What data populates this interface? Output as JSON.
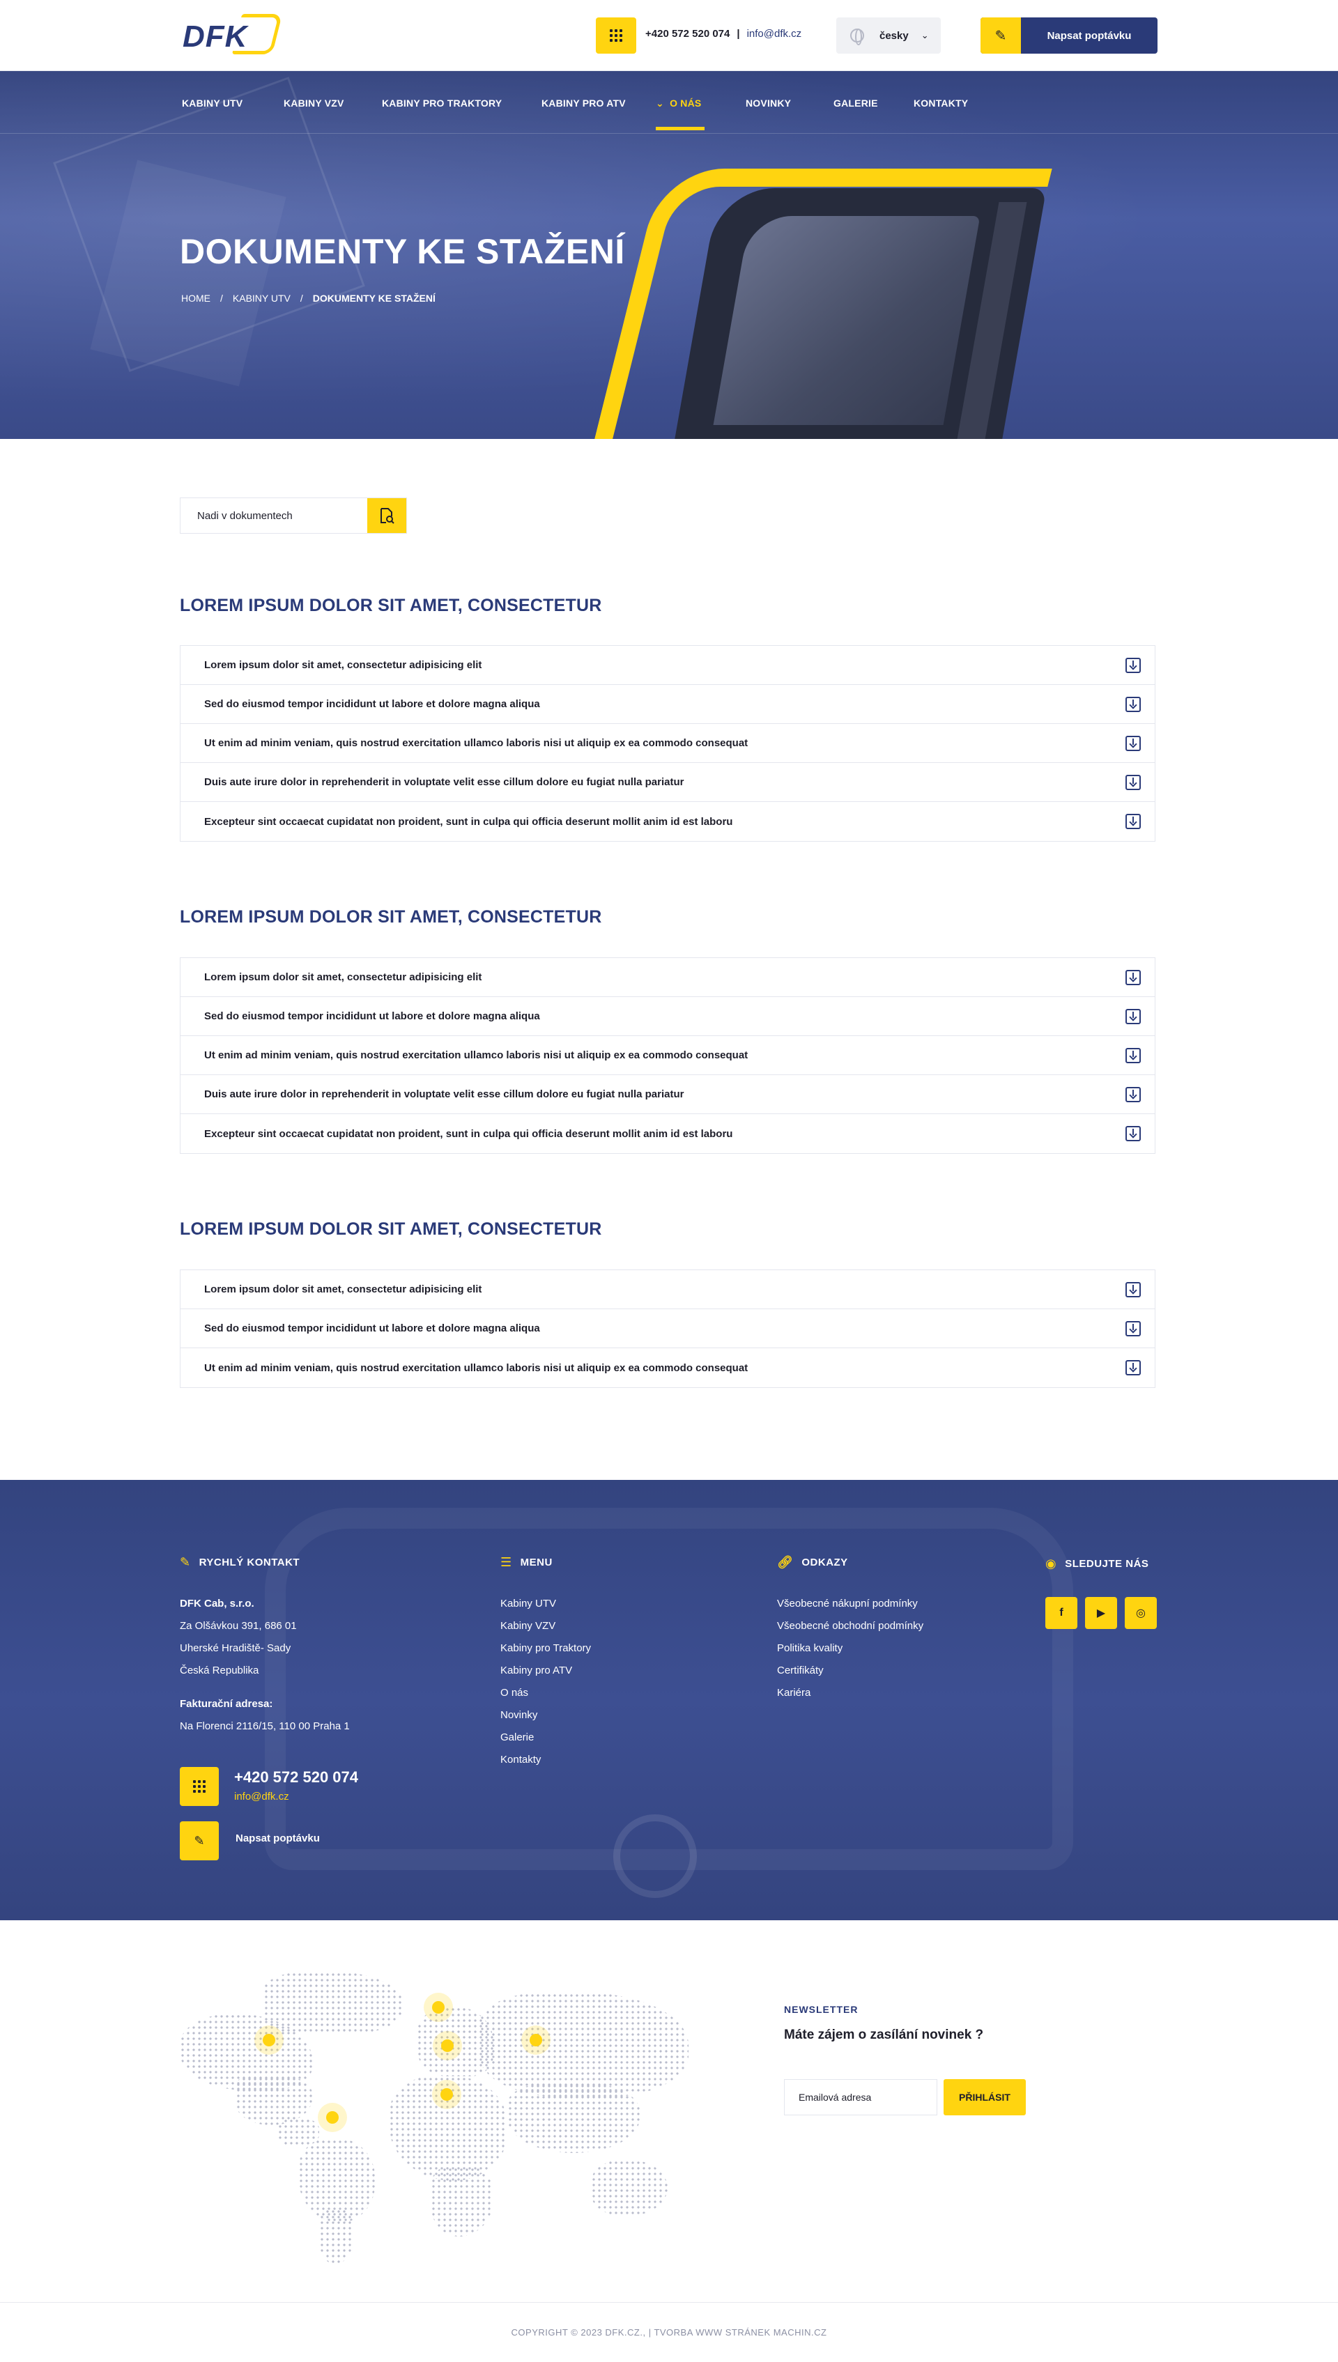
{
  "header": {
    "logo_text": "DFK",
    "phone": "+420 572 520 074",
    "separator": "|",
    "email": "info@dfk.cz",
    "language": "česky",
    "cta_label": "Napsat poptávku"
  },
  "nav": {
    "items": [
      {
        "label": "KABINY UTV"
      },
      {
        "label": "KABINY VZV"
      },
      {
        "label": "KABINY PRO TRAKTORY"
      },
      {
        "label": "KABINY PRO ATV"
      },
      {
        "label": "O NÁS"
      },
      {
        "label": "NOVINKY"
      },
      {
        "label": "GALERIE"
      },
      {
        "label": "KONTAKTY"
      }
    ],
    "active_index": 4
  },
  "hero": {
    "title": "DOKUMENTY KE STAŽENÍ",
    "breadcrumb": [
      "HOME",
      "KABINY UTV",
      "DOKUMENTY KE STAŽENÍ"
    ],
    "breadcrumb_sep": "/"
  },
  "search": {
    "placeholder": "Nadi v dokumentech"
  },
  "sections": [
    {
      "title": "LOREM IPSUM DOLOR SIT AMET, CONSECTETUR",
      "docs": [
        "Lorem ipsum dolor sit amet, consectetur adipisicing elit",
        "Sed do eiusmod tempor incididunt ut labore et dolore magna aliqua",
        "Ut enim ad minim veniam, quis nostrud exercitation ullamco laboris nisi ut aliquip ex ea commodo consequat",
        " Duis aute irure dolor in reprehenderit in voluptate velit esse cillum dolore eu fugiat nulla pariatur",
        "Excepteur sint occaecat cupidatat non proident, sunt in culpa qui officia deserunt mollit anim id est laboru"
      ]
    },
    {
      "title": "LOREM IPSUM DOLOR SIT AMET, CONSECTETUR",
      "docs": [
        "Lorem ipsum dolor sit amet, consectetur adipisicing elit",
        "Sed do eiusmod tempor incididunt ut labore et dolore magna aliqua",
        "Ut enim ad minim veniam, quis nostrud exercitation ullamco laboris nisi ut aliquip ex ea commodo consequat",
        " Duis aute irure dolor in reprehenderit in voluptate velit esse cillum dolore eu fugiat nulla pariatur",
        "Excepteur sint occaecat cupidatat non proident, sunt in culpa qui officia deserunt mollit anim id est laboru"
      ]
    },
    {
      "title": "LOREM IPSUM DOLOR SIT AMET, CONSECTETUR",
      "docs": [
        "Lorem ipsum dolor sit amet, consectetur adipisicing elit",
        "Sed do eiusmod tempor incididunt ut labore et dolore magna aliqua",
        "Ut enim ad minim veniam, quis nostrud exercitation ullamco laboris nisi ut aliquip ex ea commodo consequat"
      ]
    }
  ],
  "footer": {
    "contact": {
      "heading": "RYCHLÝ KONTAKT",
      "company": "DFK Cab, s.r.o.",
      "address": [
        "Za Olšávkou 391, 686 01",
        "Uherské Hradiště- Sady",
        "Česká Republika"
      ],
      "billing_label": "Fakturační adresa:",
      "billing": "Na Florenci 2116/15,  110 00 Praha 1",
      "phone": "+420 572 520 074",
      "email": "info@dfk.cz",
      "cta_label": "Napsat poptávku"
    },
    "menu": {
      "heading": "MENU",
      "items": [
        "Kabiny UTV",
        "Kabiny VZV",
        "Kabiny pro Traktory",
        "Kabiny pro ATV",
        "O nás",
        "Novinky",
        "Galerie",
        "Kontakty"
      ]
    },
    "links": {
      "heading": "ODKAZY",
      "items": [
        "Všeobecné nákupní podmínky",
        "Všeobecné obchodní podmínky",
        "Politika kvality",
        "Certifikáty",
        "Kariéra"
      ]
    },
    "social": {
      "heading": "SLEDUJTE NÁS",
      "items": [
        {
          "name": "facebook-icon",
          "glyph": "f"
        },
        {
          "name": "youtube-icon",
          "glyph": "▶"
        },
        {
          "name": "instagram-icon",
          "glyph": "◎"
        }
      ]
    }
  },
  "newsletter": {
    "kicker": "NEWSLETTER",
    "title": "Máte zájem o zasílání novinek ?",
    "placeholder": "Emailová adresa",
    "button": "PŘIHLÁSIT"
  },
  "copyright": "COPYRIGHT © 2023 DFK.CZ.,  |  TVORBA WWW STRÁNEK MACHIN.CZ",
  "colors": {
    "brand_blue": "#2a3a78",
    "accent_yellow": "#ffd410"
  }
}
